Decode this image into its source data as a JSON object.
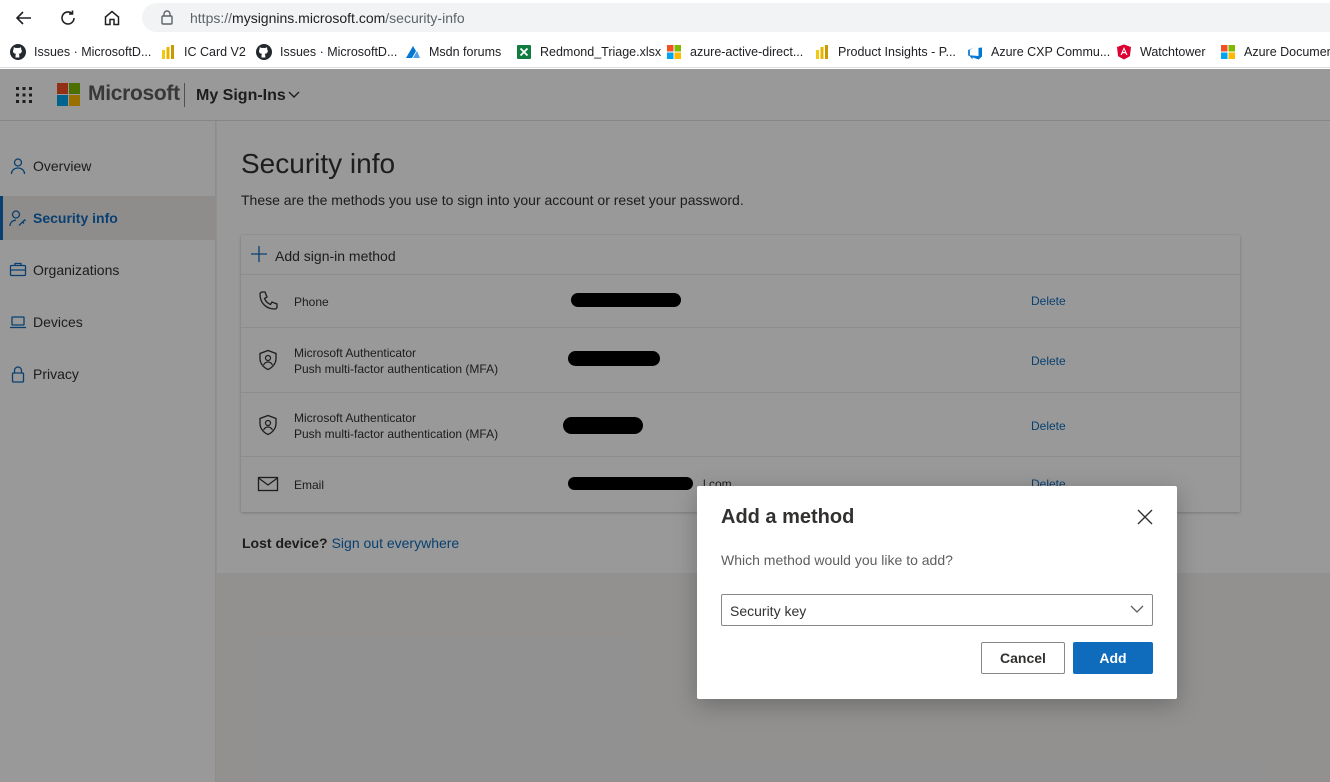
{
  "browser": {
    "url_scheme": "https://",
    "url_host": "mysignins.microsoft.com",
    "url_path": "/security-info",
    "bookmarks": [
      {
        "label": "Issues · MicrosoftD...",
        "icon": "github-icon"
      },
      {
        "label": "IC Card V2",
        "icon": "powerbi-icon"
      },
      {
        "label": "Issues · MicrosoftD...",
        "icon": "github-icon"
      },
      {
        "label": "Msdn forums",
        "icon": "msdn-icon"
      },
      {
        "label": "Redmond_Triage.xlsx",
        "icon": "excel-icon"
      },
      {
        "label": "azure-active-direct...",
        "icon": "microsoft-icon"
      },
      {
        "label": "Product Insights - P...",
        "icon": "powerbi-icon"
      },
      {
        "label": "Azure CXP Commu...",
        "icon": "azure-devops-icon"
      },
      {
        "label": "Watchtower",
        "icon": "angular-icon"
      },
      {
        "label": "Azure Documen",
        "icon": "microsoft-icon"
      }
    ]
  },
  "header": {
    "brand": "Microsoft",
    "app_title": "My Sign-Ins"
  },
  "sidebar": {
    "items": [
      {
        "label": "Overview",
        "icon": "person-icon"
      },
      {
        "label": "Security info",
        "icon": "person-key-icon",
        "active": true
      },
      {
        "label": "Organizations",
        "icon": "briefcase-icon"
      },
      {
        "label": "Devices",
        "icon": "laptop-icon"
      },
      {
        "label": "Privacy",
        "icon": "lock-icon"
      }
    ]
  },
  "main": {
    "title": "Security info",
    "subtitle": "These are the methods you use to sign into your account or reset your password.",
    "add_method_label": "Add sign-in method",
    "methods": [
      {
        "name": "Phone",
        "detail": "",
        "icon": "phone-icon",
        "delete_label": "Delete"
      },
      {
        "name": "Microsoft Authenticator",
        "detail": "Push multi-factor authentication (MFA)",
        "icon": "authenticator-icon",
        "delete_label": "Delete"
      },
      {
        "name": "Microsoft Authenticator",
        "detail": "Push multi-factor authentication (MFA)",
        "icon": "authenticator-icon",
        "delete_label": "Delete"
      },
      {
        "name": "Email",
        "detail": "",
        "icon": "mail-icon",
        "value_suffix": "l.com",
        "delete_label": "Delete"
      }
    ],
    "lost_device_label": "Lost device?",
    "sign_out_link": "Sign out everywhere"
  },
  "dialog": {
    "title": "Add a method",
    "prompt": "Which method would you like to add?",
    "selected_method": "Security key",
    "cancel_label": "Cancel",
    "add_label": "Add"
  },
  "colors": {
    "accent": "#0f6cbd",
    "ms_red": "#f25022",
    "ms_green": "#7fba00",
    "ms_blue": "#00a4ef",
    "ms_yellow": "#ffb900"
  }
}
